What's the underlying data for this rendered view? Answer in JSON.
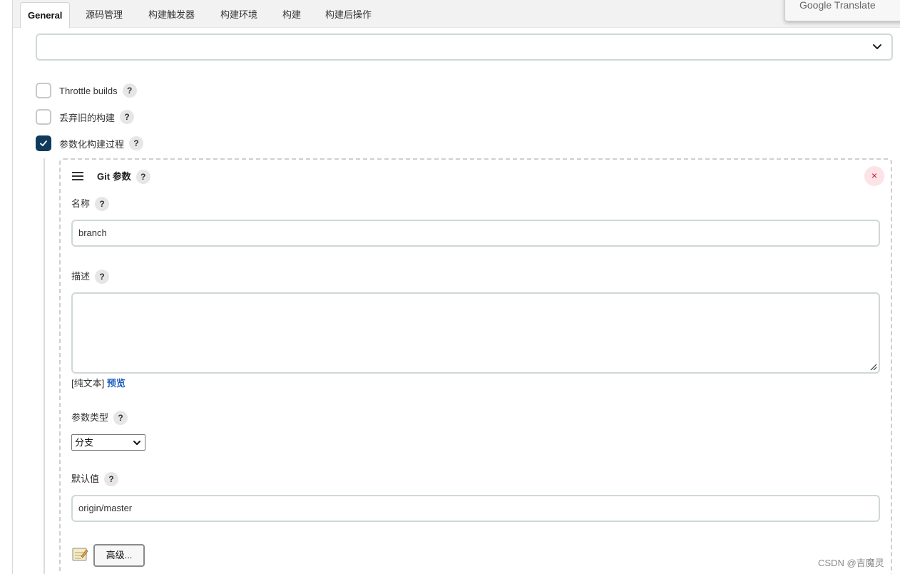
{
  "tabs": {
    "general": "General",
    "scm": "源码管理",
    "triggers": "构建触发器",
    "env": "构建环境",
    "build": "构建",
    "post": "构建后操作"
  },
  "translate_popup": "Google Translate",
  "options": {
    "throttle": {
      "label": "Throttle builds",
      "checked": false
    },
    "discard": {
      "label": "丢弃旧的构建",
      "checked": false
    },
    "parameterized": {
      "label": "参数化构建过程",
      "checked": true
    }
  },
  "help_label": "?",
  "param": {
    "title": "Git 参数",
    "delete_label": "×",
    "name_label": "名称",
    "name_value": "branch",
    "desc_label": "描述",
    "desc_value": "",
    "plain_text_prefix": "[纯文本]",
    "preview_label": "预览",
    "type_label": "参数类型",
    "type_value": "分支",
    "default_label": "默认值",
    "default_value": "origin/master",
    "advanced_label": "高级..."
  },
  "watermark": "CSDN @吉魔灵"
}
